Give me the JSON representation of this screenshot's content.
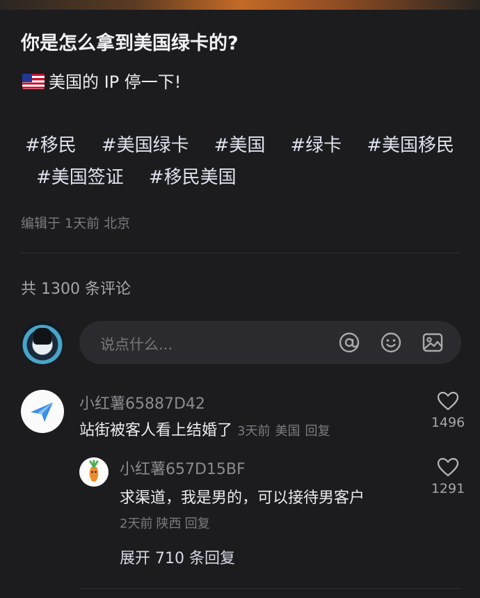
{
  "post": {
    "title": "你是怎么拿到美国绿卡的?",
    "body": "美国的 IP 停一下!",
    "tags_row1": [
      "#移民",
      "#美国绿卡",
      "#美国",
      "#绿卡",
      "#美国移民"
    ],
    "tags_row2": [
      "#美国签证",
      "#移民美国"
    ],
    "meta": "编辑于 1天前 北京"
  },
  "comments_header": {
    "count_label": "共 1300 条评论"
  },
  "comment_input": {
    "placeholder": "说点什么...",
    "icons": [
      "at-icon",
      "emoji-icon",
      "image-icon"
    ]
  },
  "comments": [
    {
      "username": "小红薯65887D42",
      "text": "站街被客人看上结婚了",
      "time": "3天前",
      "location": "美国",
      "reply_label": "回复",
      "likes": "1496",
      "avatar_icon": "paper-plane-icon"
    }
  ],
  "replies": [
    {
      "username": "小红薯657D15BF",
      "text": "求渠道，我是男的，可以接待男客户",
      "time": "2天前",
      "location": "陕西",
      "reply_label": "回复",
      "likes": "1291",
      "avatar_icon": "carrot-icon"
    }
  ],
  "expand_label": "展开 710 条回复",
  "colors": {
    "background": "#1c1c1f",
    "text_primary": "#ececef",
    "text_secondary": "#8b8b90",
    "tag": "#dfe3ee"
  }
}
